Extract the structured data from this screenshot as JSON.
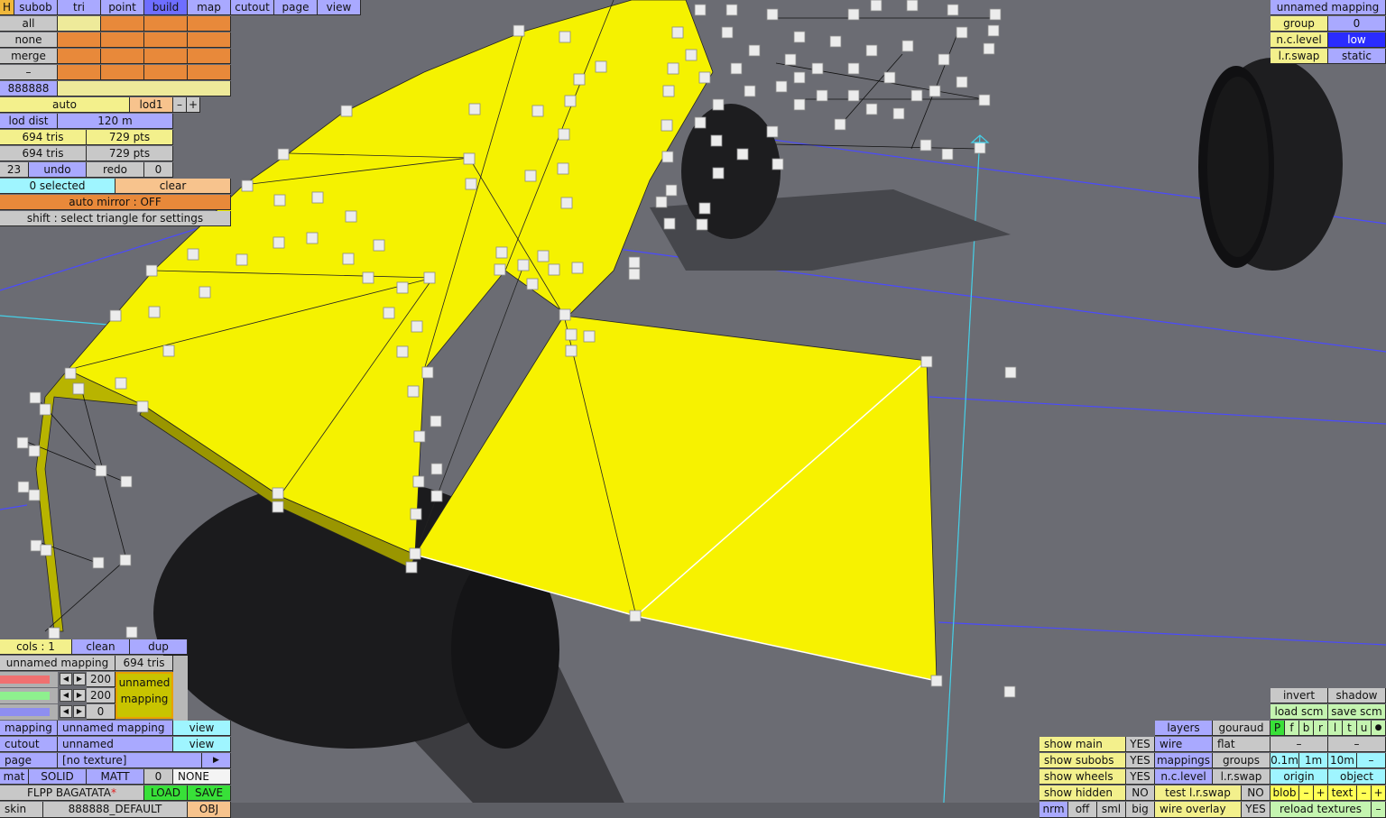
{
  "top_menu": {
    "h": "H",
    "items": [
      "subob",
      "tri",
      "point",
      "build",
      "map",
      "cutout",
      "page",
      "view"
    ]
  },
  "left_panel": {
    "select_rows": [
      "all",
      "none",
      "merge",
      "–"
    ],
    "color_code": "888888",
    "auto": "auto",
    "lod": "lod1",
    "minus": "–",
    "plus": "+",
    "lod_dist_label": "lod dist",
    "lod_dist_value": "120 m",
    "tris1": "694 tris",
    "pts1": "729 pts",
    "tris2": "694 tris",
    "pts2": "729 pts",
    "undo_count": "23",
    "undo": "undo",
    "redo": "redo",
    "redo_count": "0",
    "selected": "0 selected",
    "clear": "clear",
    "auto_mirror": "auto mirror : OFF",
    "shift_hint": "shift : select triangle for settings"
  },
  "right_top": {
    "title": "unnamed mapping",
    "group_label": "group",
    "group_value": "0",
    "nc_label": "n.c.level",
    "nc_value": "low",
    "lr_label": "l.r.swap",
    "lr_value": "static"
  },
  "bottom_left": {
    "cols": "cols : 1",
    "clean": "clean",
    "dup": "dup",
    "mapping_name": "unnamed mapping",
    "tris": "694 tris",
    "slider_vals": [
      "200",
      "200",
      "0"
    ],
    "preview": "unnamed mapping",
    "mapping_label": "mapping",
    "mapping_value": "unnamed mapping",
    "view": "view",
    "cutout_label": "cutout",
    "cutout_value": "unnamed",
    "view2": "view",
    "page_label": "page",
    "page_value": "[no texture]",
    "page_arrow": "▶",
    "mat": "mat",
    "solid": "SOLID",
    "matt": "MATT",
    "mat_num": "0",
    "none": "NONE",
    "car": "FLPP BAGATATA",
    "star": "*",
    "load": "LOAD",
    "save": "SAVE",
    "skin_label": "skin",
    "skin_value": "888888_DEFAULT",
    "obj": "OBJ"
  },
  "bottom_right": {
    "show": [
      {
        "label": "show main",
        "value": "YES"
      },
      {
        "label": "show subobs",
        "value": "YES"
      },
      {
        "label": "show wheels",
        "value": "YES"
      },
      {
        "label": "show hidden",
        "value": "NO"
      }
    ],
    "nrm": "nrm",
    "off": "off",
    "sml": "sml",
    "big": "big",
    "layers": "layers",
    "gouraud": "gouraud",
    "wire": "wire",
    "flat": "flat",
    "mappings": "mappings",
    "groups": "groups",
    "nclevel": "n.c.level",
    "lrswap": "l.r.swap",
    "test_lr": "test l.r.swap",
    "test_lr_val": "NO",
    "wire_overlay": "wire overlay",
    "wire_overlay_val": "YES",
    "invert": "invert",
    "shadow": "shadow",
    "load_scm": "load scm",
    "save_scm": "save scm",
    "channels": [
      "P",
      "f",
      "b",
      "r",
      "l",
      "t",
      "u",
      "●"
    ],
    "dash1": "–",
    "dash2": "–",
    "steps": [
      "0.1m",
      "1m",
      "10m",
      "–"
    ],
    "origin": "origin",
    "object": "object",
    "blob": "blob",
    "text": "text",
    "minus": "–",
    "plus": "+",
    "reload": "reload textures",
    "end_minus": "–"
  }
}
